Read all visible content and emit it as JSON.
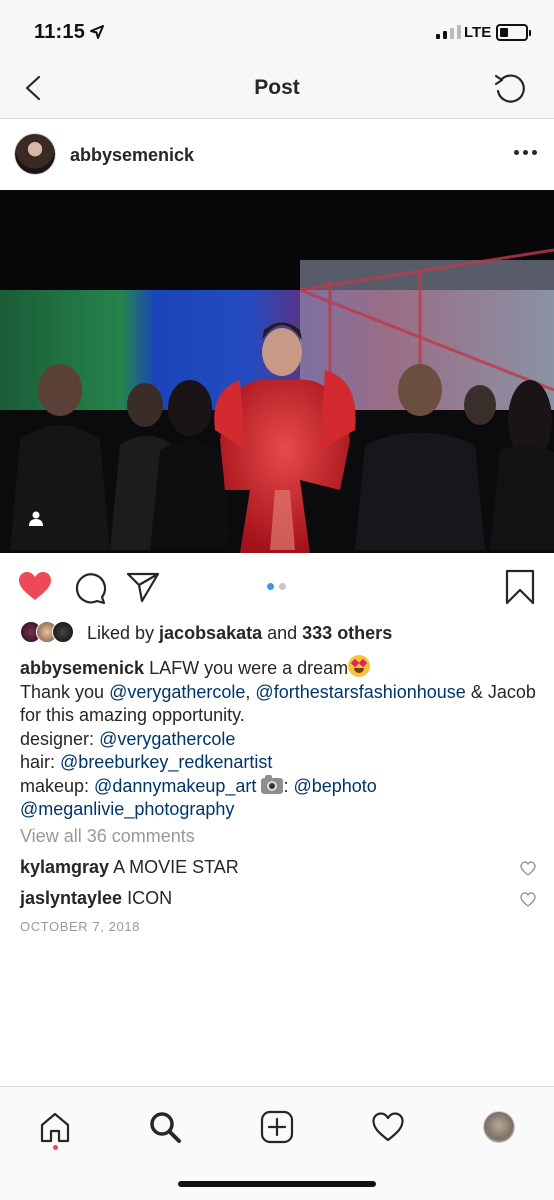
{
  "status_bar": {
    "time": "11:15",
    "network": "LTE"
  },
  "nav": {
    "title": "Post",
    "back_icon": "chevron-left-icon",
    "refresh_icon": "refresh-icon"
  },
  "post": {
    "username": "abbysemenick",
    "more_icon": "ellipsis-icon",
    "carousel": {
      "count": 2,
      "active": 1
    },
    "liked": true
  },
  "likes": {
    "prefix": "Liked by ",
    "user": "jacobsakata",
    "middle": " and ",
    "others": "333 others"
  },
  "caption": {
    "user": "abbysemenick",
    "line1": " LAFW you were a dream",
    "line2_prefix": "Thank you ",
    "mention1": "@verygathercole",
    "comma": ", ",
    "mention2": "@forthestarsfashionhouse",
    "line2_suffix": " & Jacob for this amazing opportunity.",
    "designer_label": "designer: ",
    "designer": "@verygathercole",
    "hair_label": "hair: ",
    "hair": "@breeburkey_redkenartist",
    "makeup_label": "makeup: ",
    "makeup": "@dannymakeup_art",
    "photo_sep": ": ",
    "photo1": "@bephoto",
    "photo2": "@meganlivie_photography"
  },
  "view_all": "View all 36 comments",
  "comments": [
    {
      "user": "kylamgray",
      "text": " A MOVIE STAR"
    },
    {
      "user": "jaslyntaylee",
      "text": " ICON"
    }
  ],
  "date": "OCTOBER 7, 2018",
  "colors": {
    "like": "#ed4956",
    "mention": "#003569",
    "active_dot": "#3897f0"
  }
}
